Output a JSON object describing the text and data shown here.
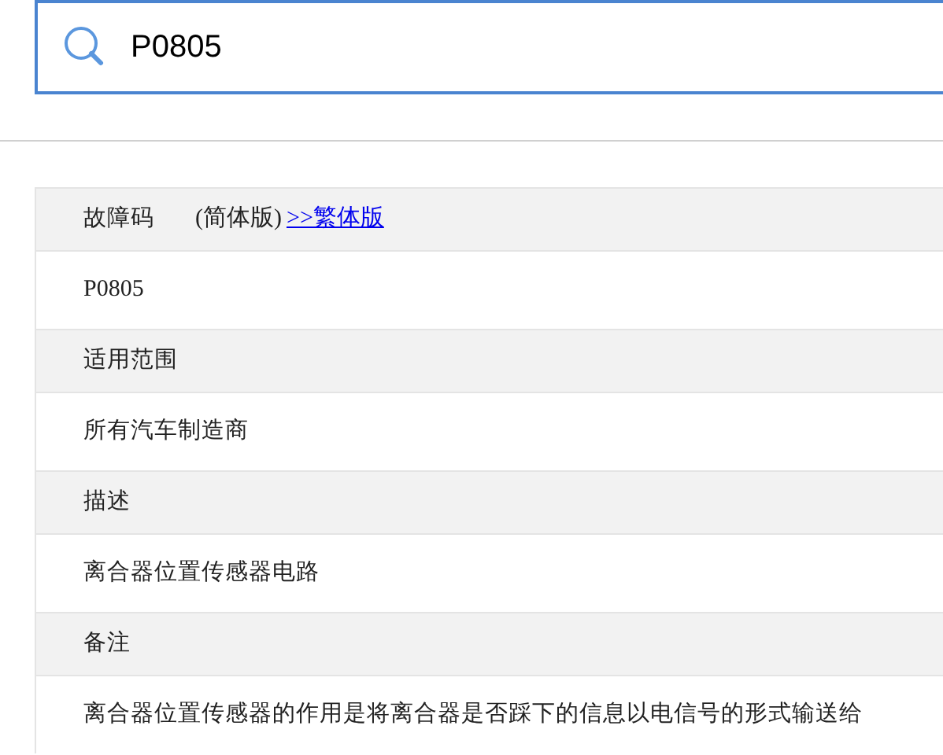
{
  "search": {
    "value": "P0805"
  },
  "sections": [
    {
      "heading": "故障码",
      "variant": "(简体版)",
      "link": ">>繁体版",
      "value": "P0805",
      "kind": "code"
    },
    {
      "heading": "适用范围",
      "value": "所有汽车制造商",
      "kind": "text"
    },
    {
      "heading": "描述",
      "value": "离合器位置传感器电路",
      "kind": "text"
    },
    {
      "heading": "备注",
      "value": "离合器位置传感器的作用是将离合器是否踩下的信息以电信号的形式输送给",
      "kind": "text"
    }
  ]
}
